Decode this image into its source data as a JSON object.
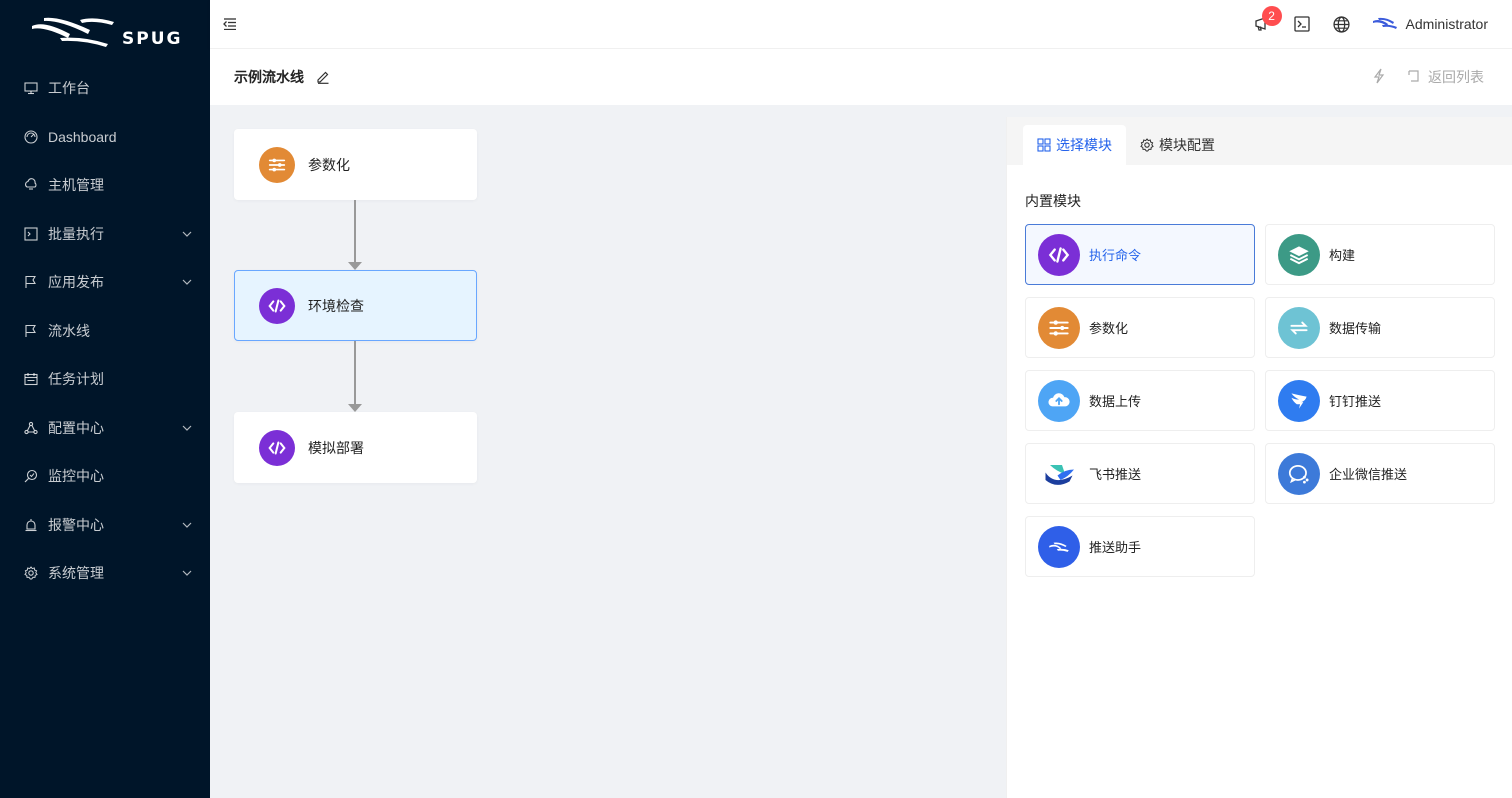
{
  "app": {
    "brand": "SPUG",
    "user": "Administrator",
    "notification_count": "2"
  },
  "sidebar": {
    "items": [
      {
        "label": "工作台",
        "icon": "desktop-icon",
        "expandable": false
      },
      {
        "label": "Dashboard",
        "icon": "dashboard-icon",
        "expandable": false
      },
      {
        "label": "主机管理",
        "icon": "cloud-server-icon",
        "expandable": false
      },
      {
        "label": "批量执行",
        "icon": "terminal-icon",
        "expandable": true
      },
      {
        "label": "应用发布",
        "icon": "flag-icon",
        "expandable": true
      },
      {
        "label": "流水线",
        "icon": "flag-icon",
        "expandable": false
      },
      {
        "label": "任务计划",
        "icon": "schedule-icon",
        "expandable": false
      },
      {
        "label": "配置中心",
        "icon": "deployment-icon",
        "expandable": true
      },
      {
        "label": "监控中心",
        "icon": "monitor-icon",
        "expandable": false
      },
      {
        "label": "报警中心",
        "icon": "alert-icon",
        "expandable": true
      },
      {
        "label": "系统管理",
        "icon": "setting-icon",
        "expandable": true
      }
    ]
  },
  "page": {
    "title": "示例流水线",
    "back_label": "返回列表"
  },
  "pipeline": {
    "nodes": [
      {
        "label": "参数化",
        "icon": "params-icon",
        "color": "#e28a35",
        "active": false
      },
      {
        "label": "环境检查",
        "icon": "code-icon",
        "color": "#7b2fd6",
        "active": true
      },
      {
        "label": "模拟部署",
        "icon": "code-icon",
        "color": "#7b2fd6",
        "active": false
      }
    ]
  },
  "panel": {
    "tabs": [
      {
        "label": "选择模块",
        "icon": "appstore-icon",
        "active": true
      },
      {
        "label": "模块配置",
        "icon": "setting-icon",
        "active": false
      }
    ],
    "section_title": "内置模块",
    "modules": [
      {
        "label": "执行命令",
        "icon": "code-icon",
        "color": "#7b2fd6",
        "selected": true
      },
      {
        "label": "构建",
        "icon": "layers-icon",
        "color": "#3c9a86",
        "selected": false
      },
      {
        "label": "参数化",
        "icon": "params-icon",
        "color": "#e28a35",
        "selected": false
      },
      {
        "label": "数据传输",
        "icon": "transfer-icon",
        "color": "#6ec3d4",
        "selected": false
      },
      {
        "label": "数据上传",
        "icon": "cloud-upload-icon",
        "color": "#4ea5f5",
        "selected": false
      },
      {
        "label": "钉钉推送",
        "icon": "dingtalk-icon",
        "color": "#2f7cf0",
        "selected": false
      },
      {
        "label": "飞书推送",
        "icon": "feishu-icon",
        "color": "#ffffff",
        "selected": false
      },
      {
        "label": "企业微信推送",
        "icon": "wecom-icon",
        "color": "#3d7ad9",
        "selected": false
      },
      {
        "label": "推送助手",
        "icon": "push-assistant-icon",
        "color": "#2f5fe8",
        "selected": false
      }
    ]
  }
}
